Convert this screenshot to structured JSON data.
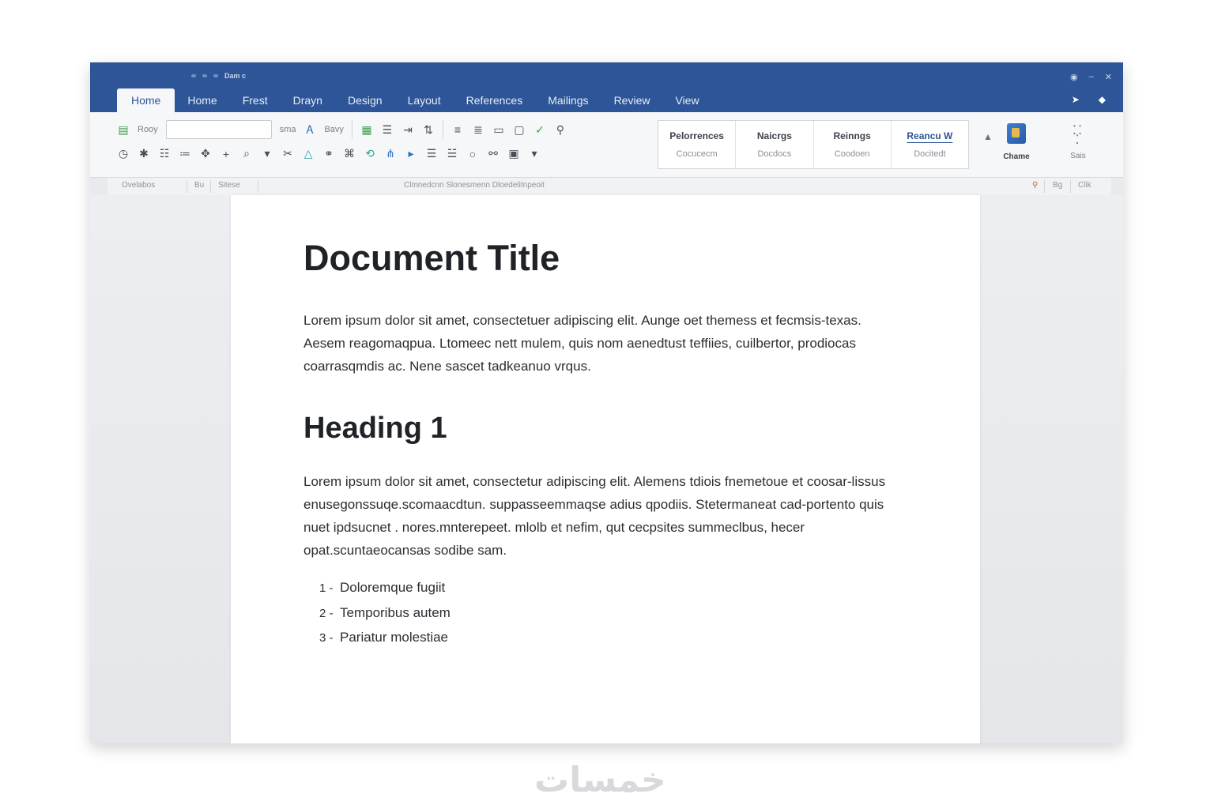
{
  "titlebar": {
    "doc_name": "Dam c",
    "tabs": [
      {
        "label": "Home",
        "active": true
      },
      {
        "label": "Home"
      },
      {
        "label": "Frest"
      },
      {
        "label": "Drayn"
      },
      {
        "label": "Design"
      },
      {
        "label": "Layout"
      },
      {
        "label": "References"
      },
      {
        "label": "Mailings"
      },
      {
        "label": "Review"
      },
      {
        "label": "View"
      }
    ]
  },
  "ribbon": {
    "row1_label": "Rooy",
    "font_size_label": "sma",
    "style_label": "Bavy",
    "styles": [
      {
        "name": "Pelorrences",
        "sub": "Cocucecm"
      },
      {
        "name": "Naicrgs",
        "sub": "Docdocs"
      },
      {
        "name": "Reinngs",
        "sub": "Coodoen"
      },
      {
        "name": "Reancu W",
        "sub": "Docitedt",
        "selected": true
      }
    ],
    "change_styles_label": "Chame",
    "find_label": "Sais"
  },
  "groupbar": {
    "left": [
      "Ovelabos",
      "Bu",
      "Sitese"
    ],
    "center": "Clmnedcnn Slonesmenn Dloedelitnpeoit",
    "right": [
      "Bg",
      "Clik"
    ]
  },
  "document": {
    "title": "Document Title",
    "paragraph1": "Lorem ipsum dolor sit amet, consectetuer adipiscing elit. Aunge oet themess et fecmsis-texas. Aesem reagomaqpua. Ltomeec nett mulem, quis nom aenedtust teffiies, cuilbertor, prodiocas coarrasqmdis ac. Nene sascet tadkeanuo vrqus.",
    "heading1": "Heading 1",
    "paragraph2": "Lorem ipsum dolor sit amet, consectetur adipiscing elit. Alemens tdiois fnemetoue et coosar-lissus enusegonssuqe.scomaacdtun. suppasseemmaqse adius qpodiis. Stetermaneat cad-portento quis nuet ipdsucnet . nores.mnterepeet. mlolb et nefim, qut cecpsites summeclbus, hecer opat.scuntaeocansas sodibe sam.",
    "list": [
      {
        "num": "1 -",
        "text": "Doloremque fugiit"
      },
      {
        "num": "2 -",
        "text": "Temporibus autem"
      },
      {
        "num": "3 -",
        "text": "Pariatur molestiae"
      }
    ]
  },
  "watermark": "خمسات"
}
